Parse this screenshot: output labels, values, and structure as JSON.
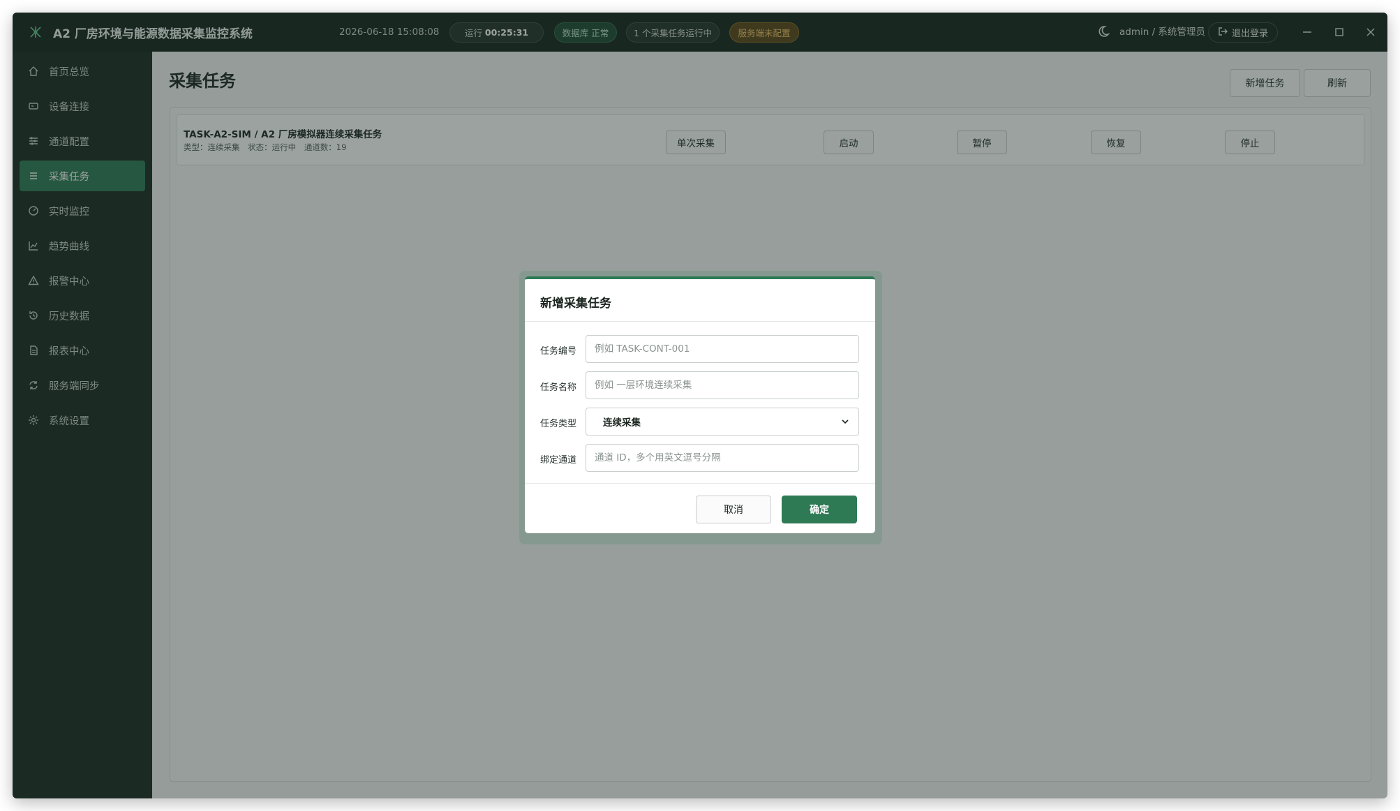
{
  "titlebar": {
    "app_title": "A2 厂房环境与能源数据采集监控系统",
    "datetime": "2026-06-18 15:08:08",
    "runtime_label": "运行",
    "runtime_value": "00:25:31",
    "db_status": "数据库 正常",
    "task_status": "1 个采集任务运行中",
    "server_status": "服务端未配置",
    "user": "admin / 系统管理员",
    "logout_label": "退出登录"
  },
  "colors": {
    "titlebar_bg": "#17241e",
    "sidebar_bg": "#1c2a23",
    "accent": "#2e7a55",
    "warning": "#f1c46a"
  },
  "sidebar": {
    "items": [
      {
        "label": "首页总览",
        "icon": "home-icon"
      },
      {
        "label": "设备连接",
        "icon": "device-icon"
      },
      {
        "label": "通道配置",
        "icon": "sliders-icon"
      },
      {
        "label": "采集任务",
        "icon": "list-icon",
        "active": true
      },
      {
        "label": "实时监控",
        "icon": "gauge-icon"
      },
      {
        "label": "趋势曲线",
        "icon": "chart-line-icon"
      },
      {
        "label": "报警中心",
        "icon": "warning-icon"
      },
      {
        "label": "历史数据",
        "icon": "history-icon"
      },
      {
        "label": "报表中心",
        "icon": "document-icon"
      },
      {
        "label": "服务端同步",
        "icon": "sync-icon"
      },
      {
        "label": "系统设置",
        "icon": "gear-icon"
      }
    ]
  },
  "main": {
    "page_title": "采集任务",
    "new_task_label": "新增任务",
    "refresh_label": "刷新",
    "task": {
      "title": "TASK-A2-SIM / A2 厂房模拟器连续采集任务",
      "type": "类型：连续采集",
      "state": "状态：运行中",
      "channels": "通道数：19",
      "actions": {
        "single": "单次采集",
        "start": "启动",
        "pause": "暂停",
        "resume": "恢复",
        "stop": "停止"
      }
    }
  },
  "dialog": {
    "title": "新增采集任务",
    "fields": {
      "task_id_label": "任务编号",
      "task_id_placeholder": "例如 TASK-CONT-001",
      "task_name_label": "任务名称",
      "task_name_placeholder": "例如 一层环境连续采集",
      "task_type_label": "任务类型",
      "task_type_value": "连续采集",
      "channels_label": "绑定通道",
      "channels_placeholder": "通道 ID，多个用英文逗号分隔"
    },
    "cancel_label": "取消",
    "confirm_label": "确定"
  }
}
